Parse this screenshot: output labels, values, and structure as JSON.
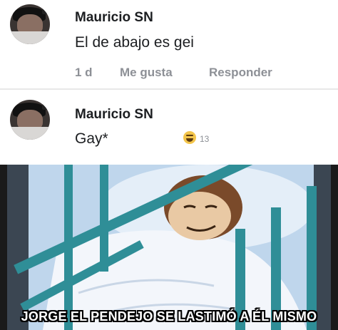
{
  "comments": [
    {
      "name": "Mauricio SN",
      "text": "El de abajo es gei",
      "time": "1 d",
      "like": "Me gusta",
      "reply": "Responder"
    },
    {
      "name": "Mauricio SN",
      "text": "Gay*",
      "reaction_count": "13"
    }
  ],
  "meme": {
    "caption": "JORGE EL PENDEJO SE LASTIMÓ A ÉL MISMO"
  },
  "colors": {
    "name_text": "#1c1e21",
    "meta_text": "#8d9096",
    "bed_teal": "#2f8e97"
  }
}
